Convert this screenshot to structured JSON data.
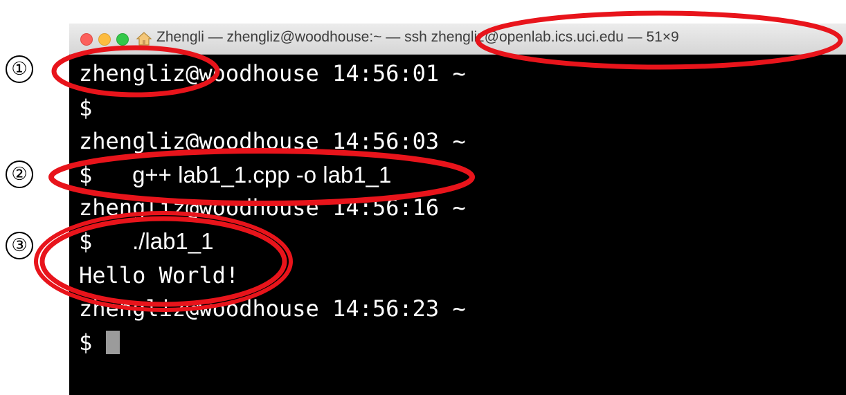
{
  "window": {
    "title": "Zhengli — zhengliz@woodhouse:~ — ssh zhengliz@openlab.ics.uci.edu — 51×9"
  },
  "terminal": {
    "lines": [
      "zhengliz@woodhouse 14:56:01 ~",
      "$",
      "zhengliz@woodhouse 14:56:03 ~",
      "$",
      "zhengliz@woodhouse 14:56:16 ~",
      "$",
      "Hello World!",
      "zhengliz@woodhouse 14:56:23 ~",
      "$"
    ],
    "commands": {
      "compile": "g++ lab1_1.cpp -o lab1_1",
      "run": "./lab1_1"
    }
  },
  "annotations": {
    "markers": [
      "①",
      "②",
      "③"
    ],
    "highlight_color": "#e8141b"
  },
  "icons": {
    "traffic_lights": [
      "close-icon",
      "minimize-icon",
      "zoom-icon"
    ],
    "title_icon": "home-icon"
  }
}
